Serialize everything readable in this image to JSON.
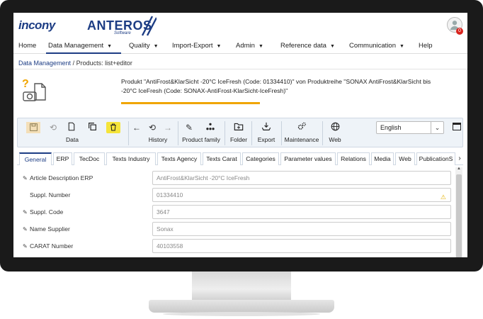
{
  "header": {
    "logo_primary": "incony",
    "logo_secondary": "ANTEROS",
    "logo_sub": "Software",
    "notification_count": "0"
  },
  "nav": {
    "items": [
      {
        "label": "Home"
      },
      {
        "label": "Data Management"
      },
      {
        "label": "Quality"
      },
      {
        "label": "Import-Export"
      },
      {
        "label": "Admin"
      },
      {
        "label": "Reference data"
      },
      {
        "label": "Communication"
      },
      {
        "label": "Help"
      }
    ]
  },
  "breadcrumb": {
    "link": "Data Management",
    "current": "Products: list+editor"
  },
  "product_info": "Produkt \"AntiFrost&KlarSicht -20°C IceFresh (Code: 01334410)\" von Produktreihe \"SONAX AntiFrost&KlarSicht bis -20°C IceFresh (Code: SONAX-AntiFrost-KlarSicht-IceFresh)\"",
  "toolbar": {
    "data_label": "Data",
    "history_label": "History",
    "product_family_label": "Product family",
    "folder_label": "Folder",
    "export_label": "Export",
    "maintenance_label": "Maintenance",
    "web_label": "Web",
    "language": "English"
  },
  "tabs": [
    {
      "label": "General"
    },
    {
      "label": "ERP"
    },
    {
      "label": "TecDoc"
    },
    {
      "label": "Texts Industry"
    },
    {
      "label": "Texts Agency"
    },
    {
      "label": "Texts Carat"
    },
    {
      "label": "Categories"
    },
    {
      "label": "Parameter values"
    },
    {
      "label": "Relations"
    },
    {
      "label": "Media"
    },
    {
      "label": "Web"
    },
    {
      "label": "PublicationS"
    }
  ],
  "fields": [
    {
      "label": "Article Description ERP",
      "value": "AntiFrost&KlarSicht -20°C IceFresh"
    },
    {
      "label": "Suppl. Number",
      "value": "01334410"
    },
    {
      "label": "Suppl. Code",
      "value": "3647"
    },
    {
      "label": "Name Supplier",
      "value": "Sonax"
    },
    {
      "label": "CARAT Number",
      "value": "40103558"
    }
  ],
  "colors": {
    "brand": "#1d3d84",
    "accent": "#f0a500",
    "highlight": "#f5e43a",
    "badge": "#d9231d"
  }
}
